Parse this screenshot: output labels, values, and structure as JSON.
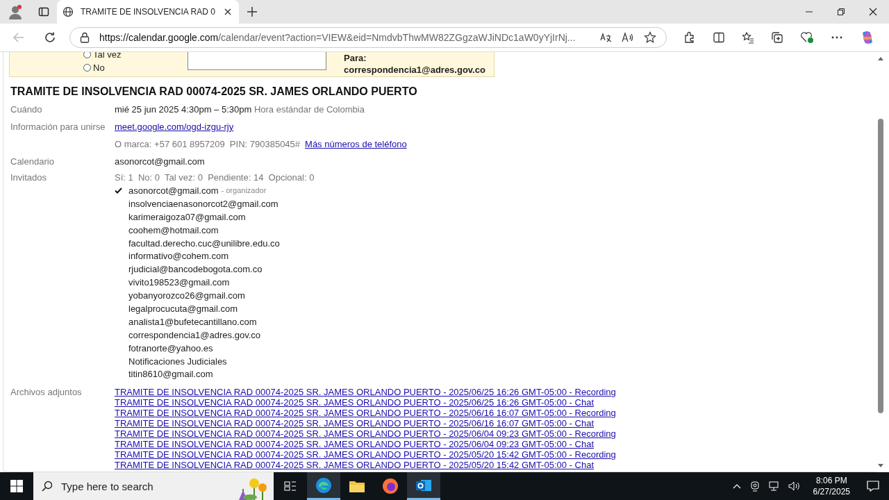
{
  "browser": {
    "tab_title": "TRAMITE DE INSOLVENCIA RAD 0",
    "url_host": "https://calendar.google.com",
    "url_path": "/calendar/event?action=VIEW&eid=NmdvbThwMW82ZGgzaWJiNDc1aW0yYjIrNj..."
  },
  "rsvp": {
    "options": [
      {
        "label": "Tal vez",
        "selected": false
      },
      {
        "label": "No",
        "selected": false
      }
    ],
    "to_label": "Para:",
    "to_value": "correspondencia1@adres.gov.co"
  },
  "event": {
    "title": "TRAMITE DE INSOLVENCIA RAD 00074-2025 SR. JAMES ORLANDO PUERTO",
    "when_label": "Cuándo",
    "when_value": "mié 25 jun 2025 4:30pm – 5:30pm",
    "when_zone": "Hora estándar de Colombia",
    "join_label": "Información para unirse",
    "join_link": "meet.google.com/ogd-izgu-rjy",
    "phone_text": "O marca: +57 601 8957209  PIN: 790385045#",
    "phone_link": "Más números de teléfono",
    "calendar_label": "Calendario",
    "calendar_value": "asonorcot@gmail.com",
    "guests_label": "Invitados",
    "guests_summary": "Sí: 1  No: 0  Tal vez: 0  Pendiente: 14  Opcional: 0",
    "guests": [
      {
        "name": "asonorcot@gmail.com",
        "accepted": true,
        "role": "- organizador"
      },
      {
        "name": "insolvenciaenasonorcot2@gmail.com",
        "accepted": false
      },
      {
        "name": "karimeraigoza07@gmail.com",
        "accepted": false
      },
      {
        "name": "coohem@hotmail.com",
        "accepted": false
      },
      {
        "name": "facultad.derecho.cuc@unilibre.edu.co",
        "accepted": false
      },
      {
        "name": "informativo@cohem.com",
        "accepted": false
      },
      {
        "name": "rjudicial@bancodebogota.com.co",
        "accepted": false
      },
      {
        "name": "vivito198523@gmail.com",
        "accepted": false
      },
      {
        "name": "yobanyorozco26@gmail.com",
        "accepted": false
      },
      {
        "name": "legalprocucuta@gmail.com",
        "accepted": false
      },
      {
        "name": "analista1@bufetecantillano.com",
        "accepted": false
      },
      {
        "name": "correspondencia1@adres.gov.co",
        "accepted": false
      },
      {
        "name": "fotranorte@yahoo.es",
        "accepted": false
      },
      {
        "name": "Notificaciones Judiciales",
        "accepted": false
      },
      {
        "name": "titin8610@gmail.com",
        "accepted": false
      }
    ],
    "attachments_label": "Archivos adjuntos",
    "attachments": [
      "TRAMITE DE INSOLVENCIA RAD 00074-2025 SR. JAMES ORLANDO PUERTO - 2025/06/25 16:26 GMT-05:00 - Recording",
      "TRAMITE DE INSOLVENCIA RAD 00074-2025 SR. JAMES ORLANDO PUERTO - 2025/06/25 16:26 GMT-05:00 - Chat",
      "TRAMITE DE INSOLVENCIA RAD 00074-2025 SR. JAMES ORLANDO PUERTO - 2025/06/16 16:07 GMT-05:00 - Recording",
      "TRAMITE DE INSOLVENCIA RAD 00074-2025 SR. JAMES ORLANDO PUERTO - 2025/06/16 16:07 GMT-05:00 - Chat",
      "TRAMITE DE INSOLVENCIA RAD 00074-2025 SR. JAMES ORLANDO PUERTO - 2025/06/04 09:23 GMT-05:00 - Recording",
      "TRAMITE DE INSOLVENCIA RAD 00074-2025 SR. JAMES ORLANDO PUERTO - 2025/06/04 09:23 GMT-05:00 - Chat",
      "TRAMITE DE INSOLVENCIA RAD 00074-2025 SR. JAMES ORLANDO PUERTO - 2025/05/20 15:42 GMT-05:00 - Recording",
      "TRAMITE DE INSOLVENCIA RAD 00074-2025 SR. JAMES ORLANDO PUERTO - 2025/05/20 15:42 GMT-05:00 - Chat"
    ]
  },
  "taskbar": {
    "search_placeholder": "Type here to search",
    "time": "8:06 PM",
    "date": "6/27/2025"
  }
}
